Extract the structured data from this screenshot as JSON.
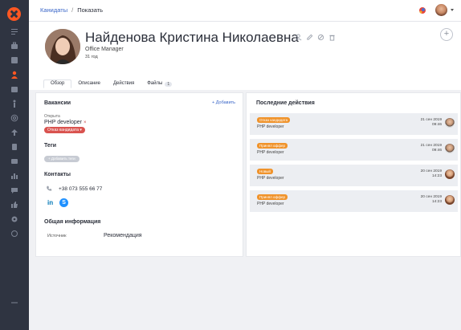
{
  "breadcrumb": {
    "parent": "Канидаты",
    "separator": "/",
    "current": "Показать"
  },
  "candidate": {
    "name": "Найденова Кристина Николаевна",
    "position": "Office Manager",
    "age": "31 год"
  },
  "tabs": [
    {
      "label": "Обзор"
    },
    {
      "label": "Описание"
    },
    {
      "label": "Действия"
    },
    {
      "label": "Файлы",
      "count": "1"
    }
  ],
  "vacancies": {
    "title": "Вакансии",
    "add_label": "+ Добавить",
    "status_label": "Открыта",
    "job": "PHP developer",
    "remove_glyph": "×",
    "stage_badge": "Отказ кандидата ▾"
  },
  "tags": {
    "title": "Теги",
    "add_label": "+ Добавить теги"
  },
  "contacts": {
    "title": "Контакты",
    "phone": "+38 073 555 66 77",
    "linkedin": "in",
    "skype": "S"
  },
  "general": {
    "title": "Общая информация",
    "source_label": "Источник",
    "source_value": "Рекомендация"
  },
  "recent": {
    "title": "Последние действия",
    "items": [
      {
        "badge": "Отказ кандидата",
        "job": "PHP developer",
        "date": "21 сен 2019",
        "time": "09:46",
        "avatar": "male"
      },
      {
        "badge": "Принял оффер",
        "job": "PHP developer",
        "date": "21 сен 2019",
        "time": "09:46",
        "avatar": "male"
      },
      {
        "badge": "Новый",
        "job": "PHP developer",
        "date": "20 сен 2019",
        "time": "14:23",
        "avatar": "female"
      },
      {
        "badge": "Принял оффер",
        "job": "PHP developer",
        "date": "20 сен 2019",
        "time": "14:23",
        "avatar": "female"
      }
    ]
  },
  "colors": {
    "accent": "#ff5722",
    "sidebar": "#2f3441",
    "badge_orange": "#f0932b",
    "badge_red": "#d9534f",
    "link": "#3a66c8"
  }
}
